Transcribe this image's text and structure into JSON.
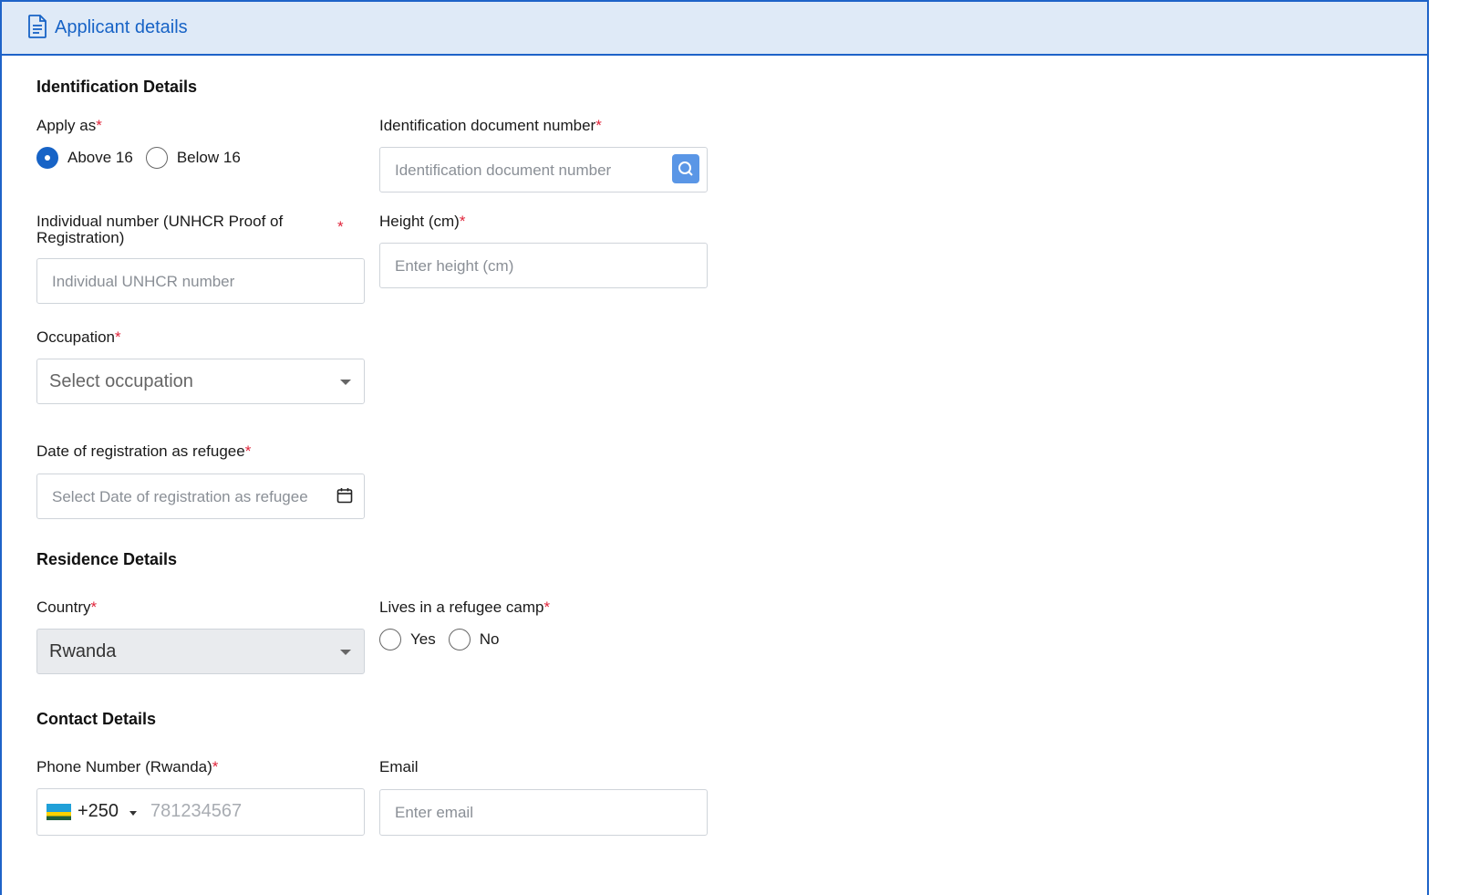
{
  "header": {
    "title": "Applicant details",
    "icon": "document-icon"
  },
  "sections": {
    "identification": "Identification Details",
    "residence": "Residence Details",
    "contact": "Contact Details"
  },
  "apply_as": {
    "label": "Apply as",
    "required": "*",
    "options": [
      {
        "label": "Above 16",
        "selected": true
      },
      {
        "label": "Below 16",
        "selected": false
      }
    ]
  },
  "id_doc": {
    "label": "Identification document number",
    "required": "*",
    "placeholder": "Identification document number"
  },
  "unhcr": {
    "label": "Individual number (UNHCR Proof of Registration)",
    "required": "*",
    "placeholder": "Individual UNHCR number"
  },
  "height": {
    "label": "Height (cm)",
    "required": "*",
    "placeholder": "Enter height (cm)"
  },
  "occupation": {
    "label": "Occupation",
    "required": "*",
    "placeholder": "Select occupation"
  },
  "reg_date": {
    "label": "Date of registration as refugee",
    "required": "*",
    "placeholder": "Select Date of registration as refugee"
  },
  "country": {
    "label": "Country",
    "required": "*",
    "value": "Rwanda"
  },
  "refugee_camp": {
    "label": "Lives in a refugee camp",
    "required": "*",
    "options": [
      {
        "label": "Yes",
        "selected": false
      },
      {
        "label": "No",
        "selected": false
      }
    ]
  },
  "phone": {
    "label": "Phone Number (Rwanda)",
    "required": "*",
    "code": "+250",
    "placeholder": "781234567"
  },
  "email": {
    "label": "Email",
    "placeholder": "Enter email"
  },
  "colors": {
    "accent": "#1763c6",
    "header_bg": "#dfeaf7",
    "required": "#e0243a",
    "disabled_bg": "#e9ebee"
  }
}
